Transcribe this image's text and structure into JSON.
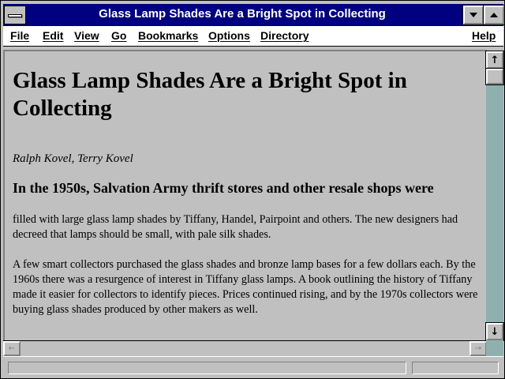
{
  "window": {
    "title": "Glass Lamp Shades Are a Bright Spot in Collecting"
  },
  "titlebar": {
    "sysmenu_icon": "system-menu-icon",
    "minimize_icon": "chevron-down-icon",
    "maximize_icon": "chevron-up-icon"
  },
  "menubar": {
    "items": [
      {
        "label": "File"
      },
      {
        "label": "Edit"
      },
      {
        "label": "View"
      },
      {
        "label": "Go"
      },
      {
        "label": "Bookmarks"
      },
      {
        "label": "Options"
      },
      {
        "label": "Directory"
      },
      {
        "label": "Help"
      }
    ]
  },
  "document": {
    "heading": "Glass Lamp Shades Are a Bright Spot in Collecting",
    "authors": "Ralph Kovel, Terry Kovel",
    "subheading": "In the 1950s, Salvation Army thrift stores and other resale shops were",
    "paragraphs": [
      "filled with large glass lamp shades by Tiffany, Handel, Pairpoint and others. The new designers had decreed that lamps should be small, with pale silk shades.",
      "A few smart collectors purchased the glass shades and bronze lamp bases for a few dollars each. By the 1960s there was a resurgence of interest in Tiffany glass lamps. A book outlining the history of Tiffany made it easier for collectors to identify pieces. Prices continued rising, and by the 1970s collectors were buying glass shades produced by other makers as well."
    ]
  },
  "scrollbar": {
    "up_glyph": "↑",
    "down_glyph": "↓",
    "left_glyph": "←",
    "right_glyph": "→"
  },
  "statusbar": {
    "text": ""
  },
  "colors": {
    "titlebar": "#000080",
    "face": "#c0c0c0",
    "desktop": "#008080"
  }
}
